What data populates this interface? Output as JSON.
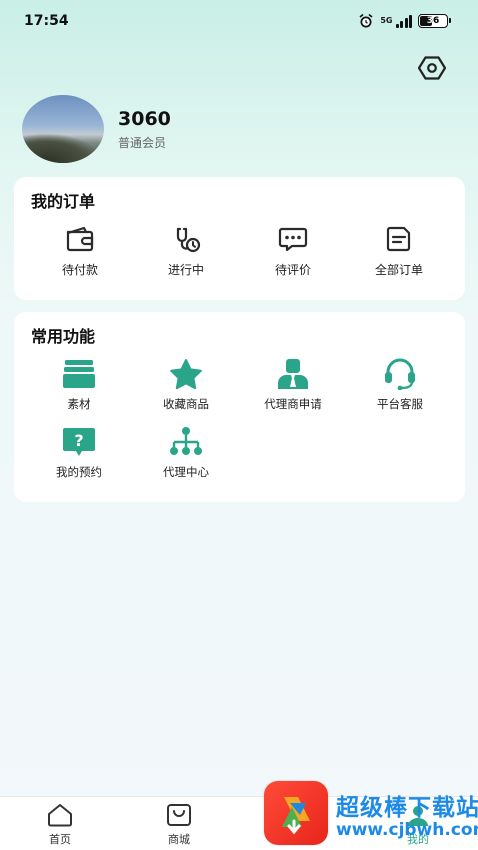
{
  "status_bar": {
    "time": "17:54",
    "network": "5G",
    "battery": "36"
  },
  "profile": {
    "username": "3060",
    "member_level": "普通会员"
  },
  "orders": {
    "title": "我的订单",
    "items": [
      {
        "label": "待付款",
        "icon": "wallet-icon"
      },
      {
        "label": "进行中",
        "icon": "clock-check-icon"
      },
      {
        "label": "待评价",
        "icon": "comment-icon"
      },
      {
        "label": "全部订单",
        "icon": "document-icon"
      }
    ]
  },
  "functions": {
    "title": "常用功能",
    "items": [
      {
        "label": "素材",
        "icon": "stack-icon"
      },
      {
        "label": "收藏商品",
        "icon": "star-icon"
      },
      {
        "label": "代理商申请",
        "icon": "agent-icon"
      },
      {
        "label": "平台客服",
        "icon": "headset-icon"
      },
      {
        "label": "我的预约",
        "icon": "question-bubble-icon"
      },
      {
        "label": "代理中心",
        "icon": "hierarchy-icon"
      }
    ]
  },
  "tab_bar": {
    "items": [
      {
        "label": "首页",
        "icon": "home-icon"
      },
      {
        "label": "商城",
        "icon": "shop-bag-icon"
      },
      {
        "label": "我的",
        "icon": "profile-icon"
      }
    ],
    "active": "我的"
  },
  "watermark": {
    "title": "超级棒下载站",
    "url": "www.cjbwh.com"
  },
  "colors": {
    "accent": "#2aa58a",
    "icon_dark": "#2b2b2b",
    "watermark_blue": "#1c8ae6"
  }
}
